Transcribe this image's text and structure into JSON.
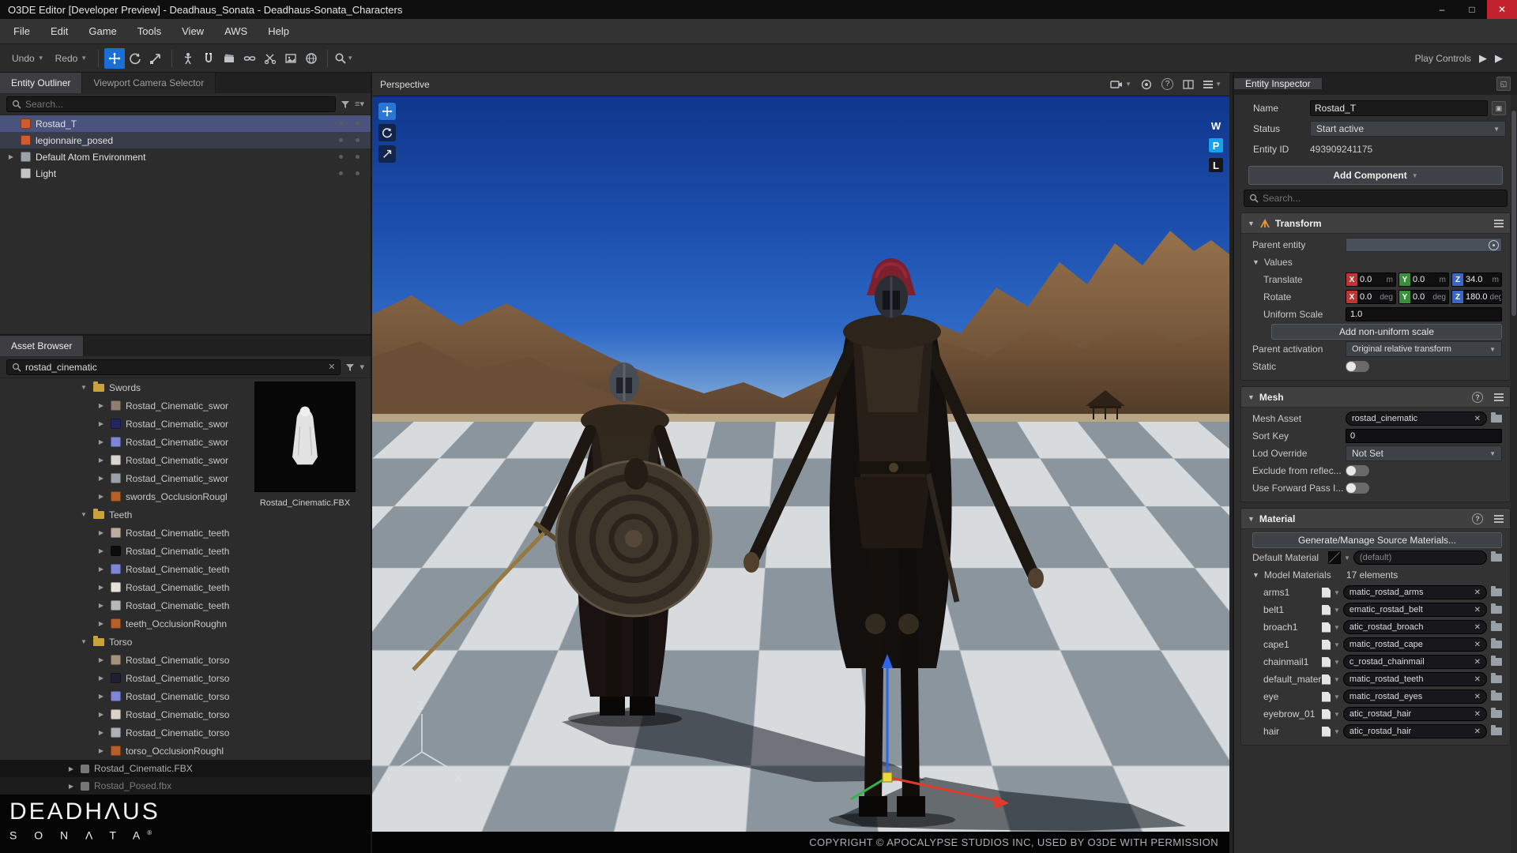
{
  "titlebar": {
    "title": "O3DE Editor [Developer Preview] - Deadhaus_Sonata - Deadhaus-Sonata_Characters"
  },
  "menubar": {
    "items": [
      "File",
      "Edit",
      "Game",
      "Tools",
      "View",
      "AWS",
      "Help"
    ]
  },
  "toolbar": {
    "undo": "Undo",
    "redo": "Redo",
    "play_controls": "Play Controls"
  },
  "outliner": {
    "tabs": [
      {
        "label": "Entity Outliner"
      },
      {
        "label": "Viewport Camera Selector"
      }
    ],
    "search_placeholder": "Search...",
    "entities": [
      {
        "label": "Rostad_T",
        "icon": "#cf5b2e"
      },
      {
        "label": "legionnaire_posed",
        "icon": "#cf5b2e"
      },
      {
        "label": "Default Atom Environment",
        "icon": "#9aa2aa"
      },
      {
        "label": "Light",
        "icon": "#c2c6ca"
      }
    ]
  },
  "asset_browser": {
    "tab": "Asset Browser",
    "search_value": "rostad_cinematic",
    "items": [
      {
        "t": "folder",
        "label": "Swords"
      },
      {
        "t": "item",
        "label": "Rostad_Cinematic_swor",
        "icon": "#8d7f6e"
      },
      {
        "t": "item",
        "label": "Rostad_Cinematic_swor",
        "icon": "#23265e"
      },
      {
        "t": "item",
        "label": "Rostad_Cinematic_swor",
        "icon": "#7e86d8"
      },
      {
        "t": "item",
        "label": "Rostad_Cinematic_swor",
        "icon": "#d8d5cf"
      },
      {
        "t": "item",
        "label": "Rostad_Cinematic_swor",
        "icon": "#9aa0a6"
      },
      {
        "t": "item",
        "label": "swords_OcclusionRougl",
        "icon": "#b55f2a"
      },
      {
        "t": "folder",
        "label": "Teeth"
      },
      {
        "t": "item",
        "label": "Rostad_Cinematic_teeth",
        "icon": "#bcae9e"
      },
      {
        "t": "item",
        "label": "Rostad_Cinematic_teeth",
        "icon": "#0c0c0c"
      },
      {
        "t": "item",
        "label": "Rostad_Cinematic_teeth",
        "icon": "#7e86d8"
      },
      {
        "t": "item",
        "label": "Rostad_Cinematic_teeth",
        "icon": "#e6e2da"
      },
      {
        "t": "item",
        "label": "Rostad_Cinematic_teeth",
        "icon": "#b8b8b8"
      },
      {
        "t": "item",
        "label": "teeth_OcclusionRoughn",
        "icon": "#b55f2a"
      },
      {
        "t": "folder",
        "label": "Torso"
      },
      {
        "t": "item",
        "label": "Rostad_Cinematic_torso",
        "icon": "#a4917e"
      },
      {
        "t": "item",
        "label": "Rostad_Cinematic_torso",
        "icon": "#1e2030"
      },
      {
        "t": "item",
        "label": "Rostad_Cinematic_torso",
        "icon": "#7e86d8"
      },
      {
        "t": "item",
        "label": "Rostad_Cinematic_torso",
        "icon": "#d8d2c8"
      },
      {
        "t": "item",
        "label": "Rostad_Cinematic_torso",
        "icon": "#aab0b6"
      },
      {
        "t": "item",
        "label": "torso_OcclusionRoughl",
        "icon": "#b55f2a"
      }
    ],
    "source_files": [
      "Rostad_Cinematic.FBX",
      "Rostad_Posed.fbx"
    ],
    "preview_caption": "Rostad_Cinematic.FBX"
  },
  "viewport": {
    "header": "Perspective",
    "wpl": [
      "W",
      "P",
      "L"
    ],
    "axes": [
      "Z",
      "Y",
      "X"
    ],
    "copyright": "COPYRIGHT © APOCALYPSE STUDIOS INC, USED BY O3DE WITH PERMISSION"
  },
  "logo": {
    "line1": "DEADHΛUS",
    "line2": "S O N Λ T A",
    "reg": "®"
  },
  "inspector": {
    "tab": "Entity Inspector",
    "name_label": "Name",
    "name_value": "Rostad_T",
    "status_label": "Status",
    "status_value": "Start active",
    "entity_id_label": "Entity ID",
    "entity_id_value": "493909241175",
    "add_component": "Add Component",
    "search_placeholder": "Search...",
    "transform": {
      "title": "Transform",
      "parent_entity_label": "Parent entity",
      "values_label": "Values",
      "translate_label": "Translate",
      "rotate_label": "Rotate",
      "uniform_scale_label": "Uniform Scale",
      "axis": {
        "x": "X",
        "y": "Y",
        "z": "Z"
      },
      "translate": {
        "x": "0.0",
        "y": "0.0",
        "z": "34.0",
        "unit": "m"
      },
      "rotate": {
        "x": "0.0",
        "y": "0.0",
        "z": "180.0",
        "unit": "deg"
      },
      "uniform_scale": "1.0",
      "add_nonuniform": "Add non-uniform scale",
      "parent_activation_label": "Parent activation",
      "parent_activation_value": "Original relative transform",
      "static_label": "Static"
    },
    "mesh": {
      "title": "Mesh",
      "mesh_asset_label": "Mesh Asset",
      "mesh_asset_value": "rostad_cinematic",
      "sort_key_label": "Sort Key",
      "sort_key_value": "0",
      "lod_override_label": "Lod Override",
      "lod_override_value": "Not Set",
      "exclude_label": "Exclude from reflec...",
      "forward_pass_label": "Use Forward Pass I..."
    },
    "material": {
      "title": "Material",
      "generate": "Generate/Manage Source Materials...",
      "default_label": "Default Material",
      "default_value": "(default)",
      "model_label": "Model Materials",
      "model_count": "17 elements",
      "slots": [
        {
          "label": "arms1",
          "value": "matic_rostad_arms"
        },
        {
          "label": "belt1",
          "value": "ematic_rostad_belt"
        },
        {
          "label": "broach1",
          "value": "atic_rostad_broach"
        },
        {
          "label": "cape1",
          "value": "matic_rostad_cape"
        },
        {
          "label": "chainmail1",
          "value": "c_rostad_chainmail"
        },
        {
          "label": "default_material",
          "value": "matic_rostad_teeth"
        },
        {
          "label": "eye",
          "value": "matic_rostad_eyes"
        },
        {
          "label": "eyebrow_01",
          "value": "atic_rostad_hair"
        },
        {
          "label": "hair",
          "value": "atic_rostad_hair"
        }
      ]
    }
  }
}
